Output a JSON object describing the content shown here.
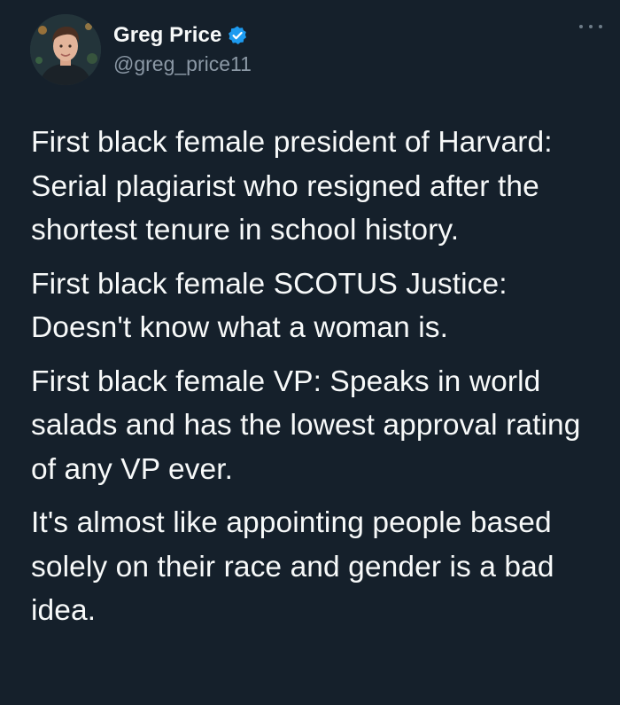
{
  "author": {
    "display_name": "Greg Price",
    "handle": "@greg_price11",
    "avatar_icon": "profile-photo",
    "verified_icon": "verified-badge-icon",
    "verified_color": "#1d9bf0"
  },
  "menu": {
    "icon": "more-options-icon"
  },
  "tweet": {
    "paragraphs": [
      "First black female president of Harvard: Serial plagiarist who resigned after the shortest tenure in school history.",
      "First black female SCOTUS Justice: Doesn't know what a woman is.",
      "First black female VP: Speaks in world salads and has the lowest approval rating of any VP ever.",
      "It's almost like appointing people based solely on their race and gender is a bad idea."
    ]
  },
  "colors": {
    "background": "#15202b",
    "text_primary": "#f7f9f9",
    "text_secondary": "#8b98a5"
  }
}
